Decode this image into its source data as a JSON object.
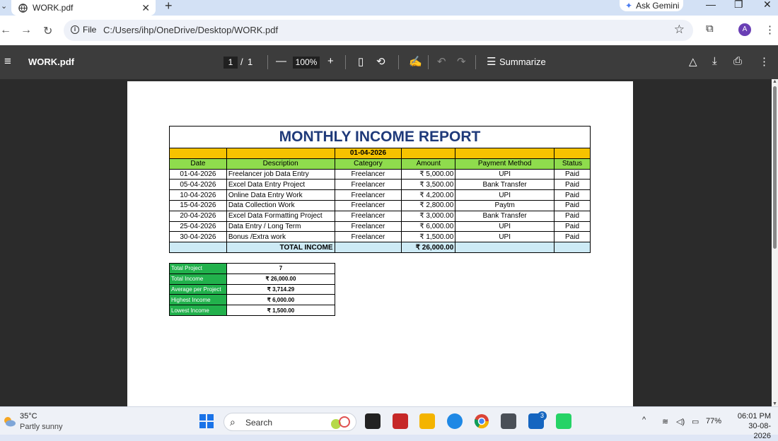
{
  "browser": {
    "tab_title": "WORK.pdf",
    "new_tab": "+",
    "gemini_label": "Ask Gemini",
    "file_label": "File",
    "url": "C:/Users/ihp/OneDrive/Desktop/WORK.pdf",
    "avatar_letter": "A"
  },
  "pdf_toolbar": {
    "filename": "WORK.pdf",
    "page_current": "1",
    "page_sep": "/",
    "page_total": "1",
    "zoom": "100%",
    "summarize_label": "Summarize"
  },
  "report": {
    "title": "MONTHLY INCOME REPORT",
    "header_date": "01-04-2026",
    "columns": [
      "Date",
      "Description",
      "Category",
      "Amount",
      "Payment Method",
      "Status"
    ],
    "rows": [
      [
        "01-04-2026",
        "Freelancer job Data Entry",
        "Freelancer",
        "₹ 5,000.00",
        "UPI",
        "Paid"
      ],
      [
        "05-04-2026",
        "Excel Data Entry Project",
        "Freelancer",
        "₹ 3,500.00",
        "Bank Transfer",
        "Paid"
      ],
      [
        "10-04-2026",
        "Online Data Entry Work",
        "Freelancer",
        "₹ 4,200.00",
        "UPI",
        "Paid"
      ],
      [
        "15-04-2026",
        "Data Collection Work",
        "Freelancer",
        "₹ 2,800.00",
        "Paytm",
        "Paid"
      ],
      [
        "20-04-2026",
        "Excel Data Formatting Project",
        "Freelancer",
        "₹ 3,000.00",
        "Bank Transfer",
        "Paid"
      ],
      [
        "25-04-2026",
        "Data Entry / Long Term",
        "Freelancer",
        "₹ 6,000.00",
        "UPI",
        "Paid"
      ],
      [
        "30-04-2026",
        "Bonus /Extra work",
        "Freelancer",
        "₹ 1,500.00",
        "UPI",
        "Paid"
      ]
    ],
    "total_label": "TOTAL INCOME",
    "total_amount": "₹ 26,000.00"
  },
  "summary": [
    {
      "label": "Total Project",
      "value": "7"
    },
    {
      "label": "Total Income",
      "value": "₹ 26,000.00"
    },
    {
      "label": "Average per Project",
      "value": "₹ 3,714.29"
    },
    {
      "label": "Highest Income",
      "value": "₹ 6,000.00"
    },
    {
      "label": "Lowest Income",
      "value": "₹ 1,500.00"
    }
  ],
  "taskbar": {
    "temperature": "35°C",
    "weather": "Partly sunny",
    "search_placeholder": "Search",
    "badge_count": "3",
    "battery": "77%",
    "time": "06:01 PM",
    "date": "30-08-2026"
  },
  "colors": {
    "title_blue": "#1f3a7a",
    "header_yellow": "#f6c200",
    "header_green": "#8fdc4d",
    "total_blue": "#cdeaf5",
    "summary_green": "#22b14c"
  }
}
